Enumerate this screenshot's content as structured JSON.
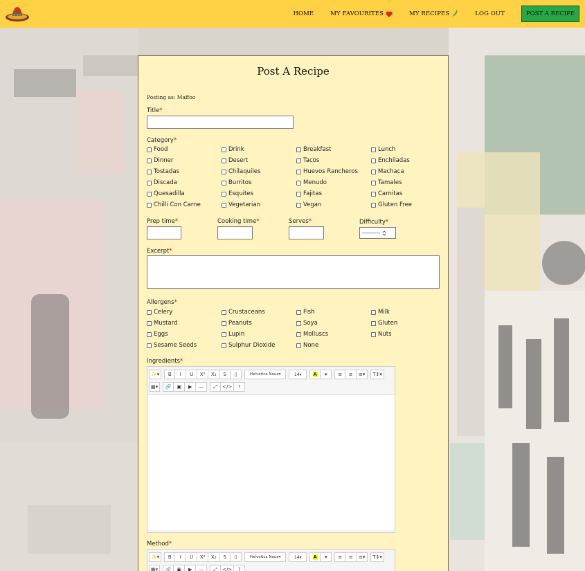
{
  "navbar": {
    "logo_icon": "sombrero-icon",
    "links": [
      {
        "label": "HOME"
      },
      {
        "label": "MY FAVOURITES",
        "icon": "heart-icon"
      },
      {
        "label": "MY RECIPES",
        "icon": "chili-pepper-icon"
      },
      {
        "label": "LOG OUT"
      }
    ],
    "post_button": "POST A RECIPE",
    "colors": {
      "bar": "#ffd145",
      "button": "#27a844"
    }
  },
  "form": {
    "title": "Post A Recipe",
    "posting_as": "Posting as: Maffoo",
    "required_marker": "*",
    "title_label": "Title",
    "category_label": "Category",
    "categories": [
      "Food",
      "Drink",
      "Breakfast",
      "Lunch",
      "Dinner",
      "Desert",
      "Tacos",
      "Enchiladas",
      "Tostadas",
      "Chilaquiles",
      "Huevos Rancheros",
      "Machaca",
      "Discada",
      "Burritos",
      "Menudo",
      "Tamales",
      "Quesadilla",
      "Esquites",
      "Fajitas",
      "Carnitas",
      "Chilli Con Carne",
      "Vegetarian",
      "Vegan",
      "Gluten Free"
    ],
    "prep_time_label": "Prep time",
    "cooking_time_label": "Cooking time",
    "serves_label": "Serves",
    "difficulty_label": "Difficulty",
    "difficulty_selected": "---------",
    "excerpt_label": "Excerpt",
    "allergens_label": "Allergens",
    "allergens": [
      "Celery",
      "Crustaceans",
      "Fish",
      "Milk",
      "Mustard",
      "Peanuts",
      "Soya",
      "Gluten",
      "Eggs",
      "Lupin",
      "Molluscs",
      "Nuts",
      "Sesame Seeds",
      "Sulphur Dioxide",
      "None"
    ],
    "ingredients_label": "Ingredients",
    "method_label": "Method"
  },
  "editor": {
    "font_name": "Helvetica Neue",
    "font_size": "14",
    "buttons": {
      "bold": "B",
      "italic": "I",
      "underline": "U",
      "superscript": "X²",
      "subscript": "X₂",
      "strikethrough": "S",
      "help": "?",
      "code": "</>"
    }
  }
}
